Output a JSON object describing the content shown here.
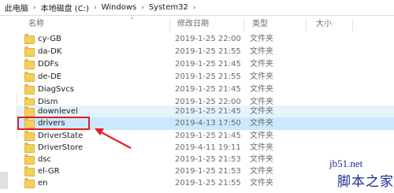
{
  "breadcrumb": {
    "items": [
      "此电脑",
      "本地磁盘 (C:)",
      "Windows",
      "System32"
    ],
    "separator": "›"
  },
  "columns": {
    "name": "名称",
    "date": "修改日期",
    "type": "类型",
    "size": "大小"
  },
  "rows": [
    {
      "name": "cy-GB",
      "date": "2019-1-25 22:00",
      "type": "文件夹"
    },
    {
      "name": "da-DK",
      "date": "2019-1-25 21:55",
      "type": "文件夹"
    },
    {
      "name": "DDFs",
      "date": "2019-1-25 21:45",
      "type": "文件夹"
    },
    {
      "name": "de-DE",
      "date": "2019-1-25 21:55",
      "type": "文件夹"
    },
    {
      "name": "DiagSvcs",
      "date": "2019-1-25 21:45",
      "type": "文件夹"
    },
    {
      "name": "Dism",
      "date": "2019-1-25 22:00",
      "type": "文件夹"
    },
    {
      "name": "downlevel",
      "date": "2019-1-25 21:45",
      "type": "文件夹"
    },
    {
      "name": "drivers",
      "date": "2019-4-13 17:50",
      "type": "文件夹"
    },
    {
      "name": "DriverState",
      "date": "2019-1-25 21:45",
      "type": "文件夹"
    },
    {
      "name": "DriverStore",
      "date": "2019-4-11 19:11",
      "type": "文件夹"
    },
    {
      "name": "dsc",
      "date": "2019-1-25 21:53",
      "type": "文件夹"
    },
    {
      "name": "el-GR",
      "date": "2019-1-25 21:53",
      "type": "文件夹"
    },
    {
      "name": "en",
      "date": "2019-1-25 21:55",
      "type": "文件夹"
    }
  ],
  "watermark": {
    "site": "jb51.net",
    "brand": "脚本之家"
  },
  "colors": {
    "selected_row": "#cce8ff",
    "hover_row": "#e5f3fb",
    "highlight": "#e01f1f",
    "folder": "#f5cf5a"
  }
}
